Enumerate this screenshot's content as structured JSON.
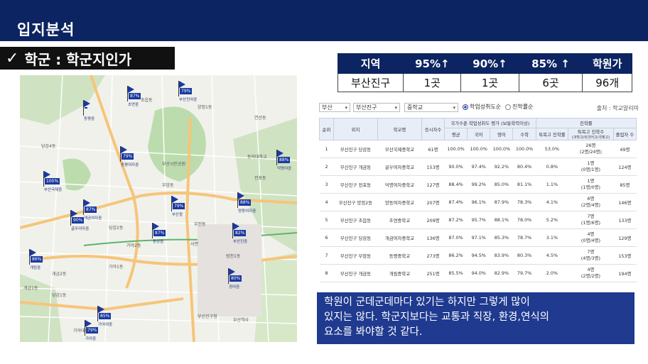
{
  "header": {
    "title": "입지분석"
  },
  "tagline": {
    "check": "✓",
    "text": "학군 : 학군지인가"
  },
  "summary_table": {
    "headers": [
      "지역",
      "95%↑",
      "90%↑",
      "85% ↑",
      "학원가"
    ],
    "row": [
      "부산진구",
      "1곳",
      "1곳",
      "6곳",
      "96개"
    ]
  },
  "filters": {
    "city": "부산",
    "district": "부산진구",
    "school_level": "중학교",
    "radio_1": "학업성취도순",
    "radio_2": "진학률순",
    "source": "출처 : 학교알리미"
  },
  "detail_table": {
    "headers": {
      "rank": "순위",
      "location": "위치",
      "school": "학교명",
      "students": "응시자수",
      "achievement_group": "국가수준 학업성취도 평가 (보통학력이상)",
      "admission_group": "진학률",
      "avg": "평균",
      "kor": "국어",
      "eng": "영어",
      "math": "수학",
      "special_rate": "특목고 진학률",
      "special_count": "특목고 진학수",
      "special_count_sub": "(과학고/외국어고/국제고)",
      "graduates": "졸업자 수"
    },
    "rows": [
      {
        "rank": "1",
        "location": "부산진구 당감동",
        "school": "부산국제중학교",
        "students": "61명",
        "avg": "100.0%",
        "kor": "100.0%",
        "eng": "100.0%",
        "math": "100.0%",
        "rate": "53.0%",
        "count": "26명",
        "count_sub": "(2명/24명)",
        "grads": "49명"
      },
      {
        "rank": "2",
        "location": "부산진구 개금동",
        "school": "골우여자중학교",
        "students": "153명",
        "avg": "90.0%",
        "kor": "97.4%",
        "eng": "92.2%",
        "math": "80.4%",
        "rate": "0.8%",
        "count": "1명",
        "count_sub": "(0명/1명)",
        "grads": "124명"
      },
      {
        "rank": "3",
        "location": "부산진구 전포동",
        "school": "덕명여자중학교",
        "students": "127명",
        "avg": "88.4%",
        "kor": "99.2%",
        "eng": "85.0%",
        "math": "81.1%",
        "rate": "1.1%",
        "count": "1명",
        "count_sub": "(1명/0명)",
        "grads": "85명"
      },
      {
        "rank": "4",
        "location": "부산진구 양정2동",
        "school": "양동여자중학교",
        "students": "207명",
        "avg": "87.4%",
        "kor": "96.1%",
        "eng": "87.9%",
        "math": "78.3%",
        "rate": "4.1%",
        "count": "6명",
        "count_sub": "(2명/4명)",
        "grads": "146명"
      },
      {
        "rank": "5",
        "location": "부산진구 초읍동",
        "school": "초연중학교",
        "students": "209명",
        "avg": "87.2%",
        "kor": "95.7%",
        "eng": "88.1%",
        "math": "78.0%",
        "rate": "5.2%",
        "count": "7명",
        "count_sub": "(1명/6명)",
        "grads": "133명"
      },
      {
        "rank": "6",
        "location": "부산진구 당감동",
        "school": "개금여자중학교",
        "students": "136명",
        "avg": "87.0%",
        "kor": "97.1%",
        "eng": "85.3%",
        "math": "78.7%",
        "rate": "3.1%",
        "count": "4명",
        "count_sub": "(0명/4명)",
        "grads": "129명"
      },
      {
        "rank": "7",
        "location": "부산진구 부암동",
        "school": "동평중학교",
        "students": "273명",
        "avg": "86.2%",
        "kor": "94.5%",
        "eng": "83.9%",
        "math": "80.3%",
        "rate": "4.5%",
        "count": "7명",
        "count_sub": "(4명/3명)",
        "grads": "153명"
      },
      {
        "rank": "8",
        "location": "부산진구 개금동",
        "school": "개림중학교",
        "students": "251명",
        "avg": "85.5%",
        "kor": "94.0%",
        "eng": "82.9%",
        "math": "79.7%",
        "rate": "2.0%",
        "count": "4명",
        "count_sub": "(2명/2명)",
        "grads": "194명"
      }
    ]
  },
  "memo": {
    "lines": [
      "학원이 군데군데마다 있기는 하지만 그렇게 많이",
      "있지는 않다. 학군지보다는 교통과 직장, 환경,연식의",
      "요소를 봐야할 것 같다."
    ]
  },
  "map": {
    "flags": [
      {
        "label": "87%",
        "school": "초연중"
      },
      {
        "label": "79%",
        "school": "부산진여중"
      },
      {
        "label": "",
        "school": "동평중"
      },
      {
        "label": "100%",
        "school": "부산국제중"
      },
      {
        "label": "79%",
        "school": "동평여자중"
      },
      {
        "label": "87%",
        "school": "개금여자중"
      },
      {
        "label": "90%",
        "school": "골우여자중"
      },
      {
        "label": "79%",
        "school": "부산중"
      },
      {
        "label": "88%",
        "school": "양동여자중"
      },
      {
        "label": "82%",
        "school": "부산진중"
      },
      {
        "label": "87%",
        "school": "동성중"
      },
      {
        "label": "86%",
        "school": "개림중"
      },
      {
        "label": "85%",
        "school": "가야여중"
      },
      {
        "label": "80%",
        "school": "경여중"
      },
      {
        "label": "79%",
        "school": "가야중"
      },
      {
        "label": "88%",
        "school": "덕명여중"
      }
    ],
    "places": [
      "당감4동",
      "당감1동",
      "당감2동",
      "부암동",
      "부전동",
      "가야1동",
      "가야2동",
      "개금1동",
      "개금2동",
      "서면",
      "범천1동",
      "양정1동",
      "연산동",
      "전포동",
      "초읍동",
      "부산진구청",
      "동의대학교",
      "부산시민공원",
      "부산역사",
      "가야대로"
    ]
  },
  "colors": {
    "header": "#0c2461",
    "memo": "#1f3a8f",
    "flag": "#1a3aa0"
  }
}
